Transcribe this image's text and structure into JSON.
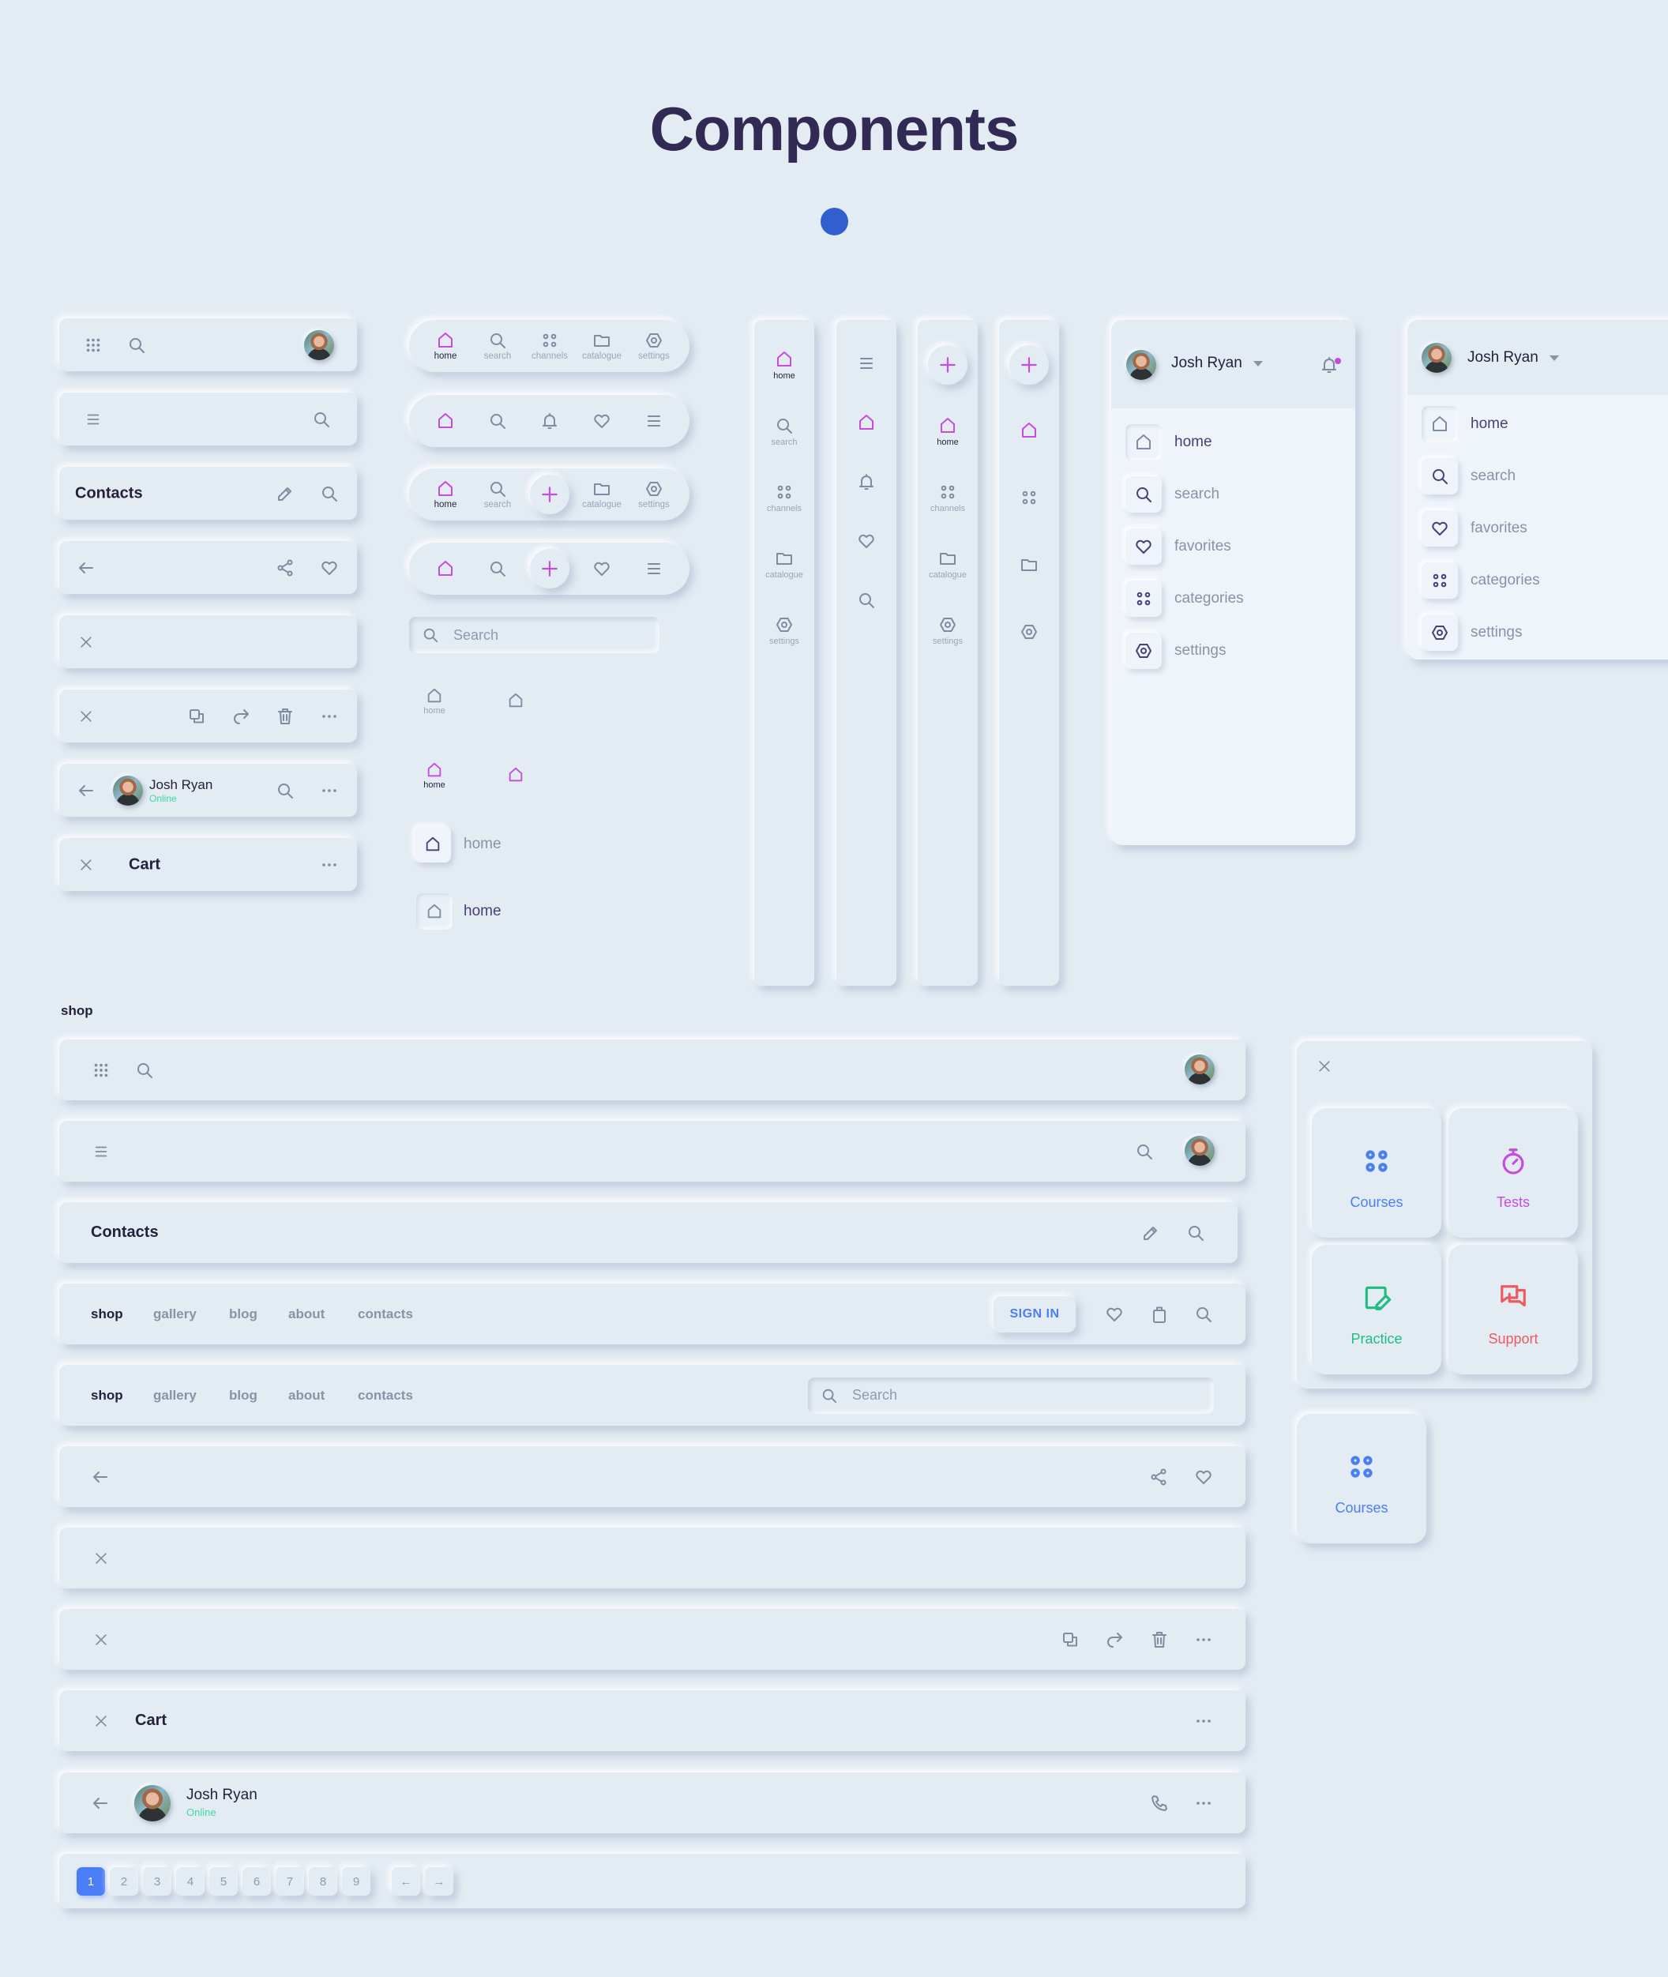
{
  "page": {
    "title": "Components",
    "accent_dot_color": "#325fd0"
  },
  "colors": {
    "accent_purple": "#c64be0",
    "accent_blue": "#4a7ef7",
    "online_green": "#3fd9a8",
    "practice_green": "#1fbd84",
    "support_red": "#ee5a5f",
    "icon_gray": "#7d8ca0",
    "bg": "#e3ebf3"
  },
  "user": {
    "name": "Josh Ryan",
    "status": "Online"
  },
  "small_bars": {
    "contacts_title": "Contacts",
    "cart_title": "Cart"
  },
  "bottom_navs": {
    "full": [
      {
        "icon": "home-icon",
        "label": "home",
        "active": true
      },
      {
        "icon": "search-icon",
        "label": "search"
      },
      {
        "icon": "channels-icon",
        "label": "channels"
      },
      {
        "icon": "folder-icon",
        "label": "catalogue"
      },
      {
        "icon": "settings-icon",
        "label": "settings"
      }
    ],
    "icons_only": [
      "home-icon",
      "search-icon",
      "bell-icon",
      "heart-icon",
      "menu-icon"
    ],
    "with_fab": [
      {
        "icon": "home-icon",
        "label": "home",
        "active": true
      },
      {
        "icon": "search-icon",
        "label": "search"
      },
      {
        "icon": "plus-icon",
        "label": ""
      },
      {
        "icon": "folder-icon",
        "label": "catalogue"
      },
      {
        "icon": "settings-icon",
        "label": "settings"
      }
    ]
  },
  "search": {
    "placeholder": "Search"
  },
  "tab_items": {
    "home_label": "home"
  },
  "rails": {
    "labeled": [
      "home",
      "search",
      "channels",
      "catalogue",
      "settings"
    ],
    "with_fab_labeled": [
      "home",
      "channels",
      "catalogue",
      "settings"
    ]
  },
  "drawer": {
    "items": [
      {
        "icon": "home-icon",
        "label": "home",
        "active": true
      },
      {
        "icon": "search-icon",
        "label": "search"
      },
      {
        "icon": "heart-icon",
        "label": "favorites"
      },
      {
        "icon": "categories-icon",
        "label": "categories"
      },
      {
        "icon": "settings-icon",
        "label": "settings"
      }
    ]
  },
  "shop": {
    "section_label": "shop",
    "contacts_title": "Contacts",
    "nav_links": [
      "shop",
      "gallery",
      "blog",
      "about",
      "contacts"
    ],
    "sign_in_label": "SIGN IN",
    "search_placeholder": "Search",
    "cart_title": "Cart"
  },
  "pagination": {
    "pages": [
      "1",
      "2",
      "3",
      "4",
      "5",
      "6",
      "7",
      "8",
      "9"
    ],
    "current": "1",
    "prev": "←",
    "next": "→"
  },
  "courses_menu": {
    "cards": [
      {
        "label": "Courses",
        "icon": "grid-dots-icon",
        "color": "#4a7ef7"
      },
      {
        "label": "Tests",
        "icon": "stopwatch-icon",
        "color": "#c64be0"
      },
      {
        "label": "Practice",
        "icon": "note-edit-icon",
        "color": "#1fbd84"
      },
      {
        "label": "Support",
        "icon": "chat-icon",
        "color": "#ee5a5f"
      }
    ],
    "single_card": {
      "label": "Courses"
    }
  }
}
